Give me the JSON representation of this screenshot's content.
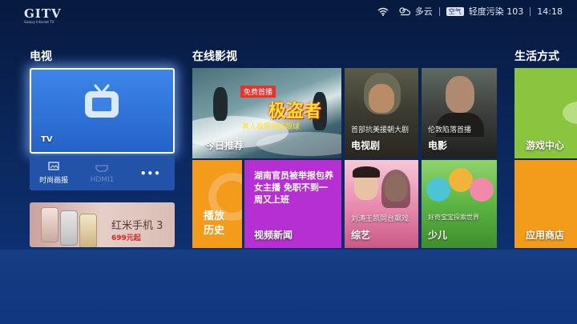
{
  "header": {
    "logo_text": "GITV",
    "logo_subtext": "Galaxy Internet TV",
    "weather": "多云",
    "air_badge": "空气",
    "air_quality": "轻度污染 103",
    "time": "14:18"
  },
  "sections": {
    "tv": "电视",
    "online_video": "在线影视",
    "lifestyle": "生活方式"
  },
  "tv_tile": {
    "label": "TV"
  },
  "tv_bar": {
    "items": [
      {
        "label": "时尚画报"
      },
      {
        "label": "HDMI1"
      },
      {
        "label": "•••"
      }
    ]
  },
  "ad_tile": {
    "title": "红米手机 3",
    "price": "699元起"
  },
  "tiles": {
    "today": {
      "label": "今日推荐",
      "badge": "免费首播",
      "big_title": "极盗者",
      "sub_title": "真人极限嗨爆眼球"
    },
    "drama": {
      "label": "电视剧",
      "caption": "首部抗美援朝大剧"
    },
    "movie": {
      "label": "电影",
      "caption": "伦敦陷落首播"
    },
    "replay": {
      "label_line1": "播放",
      "label_line2": "历史"
    },
    "news": {
      "headline": "湖南官员被举报包养女主播 免职不到一周又上班",
      "label": "视频新闻"
    },
    "variety": {
      "label": "综艺",
      "caption": "刘涛王凯同台飙戏"
    },
    "kids": {
      "label": "少儿",
      "caption": "好奇宝宝探索世界"
    },
    "game": {
      "label": "游戏中心"
    },
    "apps": {
      "label": "应用商店"
    }
  },
  "colors": {
    "background": "#0c2a63",
    "tv_tile": "#2f74dc",
    "orange": "#f39b1b",
    "purple": "#b52fd2",
    "green": "#8bc43f",
    "badge_red": "#e8322b",
    "title_yellow": "#ffe326"
  }
}
